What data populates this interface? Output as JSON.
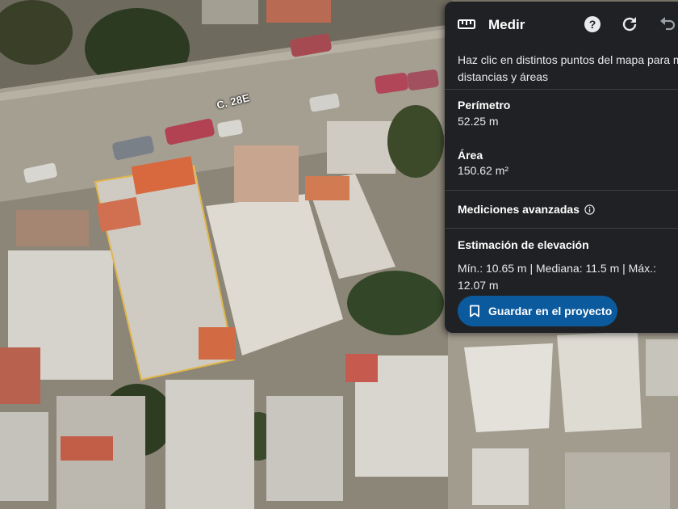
{
  "map": {
    "street_label": "C. 28E"
  },
  "panel": {
    "title": "Medir",
    "icons": {
      "ruler": "ruler-icon",
      "help": "help-icon",
      "reset": "refresh-icon",
      "undo": "undo-icon"
    },
    "intro_line1": "Haz clic en distintos puntos del mapa para m",
    "intro_line2": "distancias y áreas",
    "perimeter_label": "Perímetro",
    "perimeter_value": "52.25 m",
    "area_label": "Área",
    "area_value": "150.62 m²",
    "advanced_label": "Mediciones avanzadas",
    "elevation_label": "Estimación de elevación",
    "elevation_text": "Mín.: 10.65 m | Mediana: 11.5 m | Máx.: 12.07 m",
    "save_label": "Guardar en el proyecto",
    "accent_color": "#0c5a9e"
  }
}
